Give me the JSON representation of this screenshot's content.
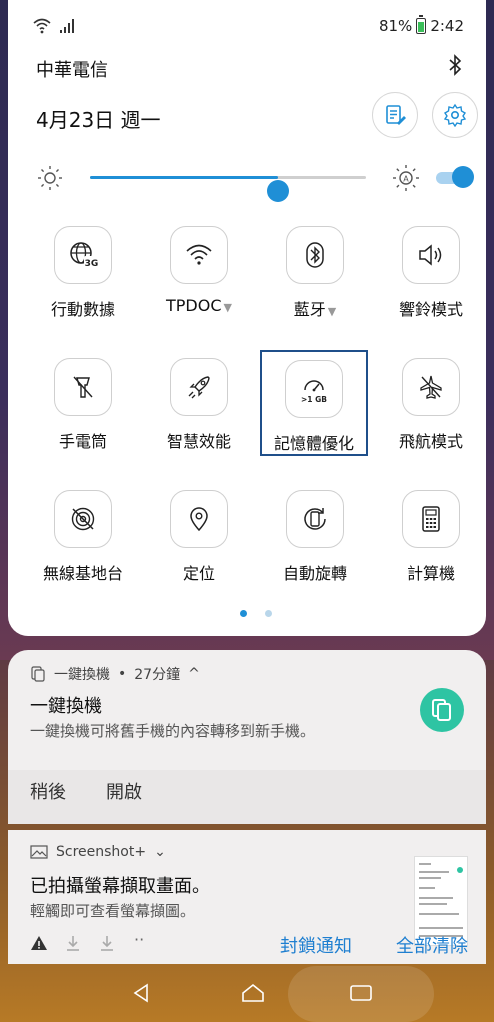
{
  "status_bar": {
    "battery": "81%",
    "time": "2:42"
  },
  "carrier": "中華電信",
  "date": "4月23日 週一",
  "brightness": {
    "level": 0.68,
    "auto_on": true
  },
  "tiles": [
    {
      "label": "行動數據",
      "icon": "mobile-data-3g-icon"
    },
    {
      "label": "TPDOC",
      "caret": "▼",
      "icon": "wifi-icon"
    },
    {
      "label": "藍牙",
      "caret": "▼",
      "icon": "bluetooth-icon"
    },
    {
      "label": "響鈴模式",
      "icon": "sound-icon"
    },
    {
      "label": "手電筒",
      "icon": "flashlight-off-icon"
    },
    {
      "label": "智慧效能",
      "icon": "rocket-icon"
    },
    {
      "label": "記憶體優化",
      "icon": "memory-boost-icon",
      "badge": ">1 GB"
    },
    {
      "label": "飛航模式",
      "icon": "airplane-off-icon"
    },
    {
      "label": "無線基地台",
      "icon": "hotspot-off-icon"
    },
    {
      "label": "定位",
      "icon": "location-icon"
    },
    {
      "label": "自動旋轉",
      "icon": "auto-rotate-icon"
    },
    {
      "label": "計算機",
      "icon": "calculator-icon"
    }
  ],
  "page_dots": {
    "active": 0,
    "count": 2
  },
  "notification1": {
    "app": "一鍵換機",
    "time": "27分鐘",
    "title": "一鍵換機",
    "text": "一鍵換機可將舊手機的內容轉移到新手機。",
    "actions": [
      "稍後",
      "開啟"
    ]
  },
  "notification2": {
    "app": "Screenshot+",
    "title": "已拍攝螢幕擷取畫面。",
    "text": "輕觸即可查看螢幕擷圖。"
  },
  "footer": {
    "block_label": "封鎖通知",
    "clear_label": "全部清除",
    "more": "··"
  },
  "colors": {
    "accent": "#1f8fd6",
    "app_teal": "#2ec4a3",
    "link": "#1f7fd0"
  }
}
